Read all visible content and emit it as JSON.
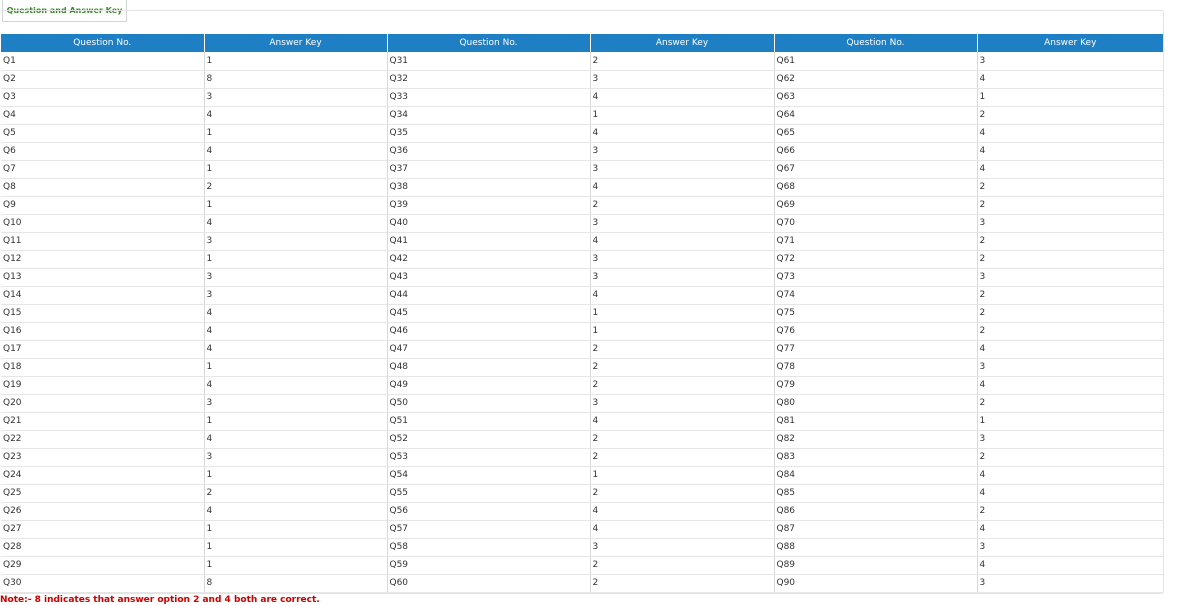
{
  "tab_label": "Question and Answer Key",
  "headers": [
    "Question No.",
    "Answer Key",
    "Question No.",
    "Answer Key",
    "Question No.",
    "Answer Key"
  ],
  "rows": [
    [
      "Q1",
      "1",
      "Q31",
      "2",
      "Q61",
      "3"
    ],
    [
      "Q2",
      "8",
      "Q32",
      "3",
      "Q62",
      "4"
    ],
    [
      "Q3",
      "3",
      "Q33",
      "4",
      "Q63",
      "1"
    ],
    [
      "Q4",
      "4",
      "Q34",
      "1",
      "Q64",
      "2"
    ],
    [
      "Q5",
      "1",
      "Q35",
      "4",
      "Q65",
      "4"
    ],
    [
      "Q6",
      "4",
      "Q36",
      "3",
      "Q66",
      "4"
    ],
    [
      "Q7",
      "1",
      "Q37",
      "3",
      "Q67",
      "4"
    ],
    [
      "Q8",
      "2",
      "Q38",
      "4",
      "Q68",
      "2"
    ],
    [
      "Q9",
      "1",
      "Q39",
      "2",
      "Q69",
      "2"
    ],
    [
      "Q10",
      "4",
      "Q40",
      "3",
      "Q70",
      "3"
    ],
    [
      "Q11",
      "3",
      "Q41",
      "4",
      "Q71",
      "2"
    ],
    [
      "Q12",
      "1",
      "Q42",
      "3",
      "Q72",
      "2"
    ],
    [
      "Q13",
      "3",
      "Q43",
      "3",
      "Q73",
      "3"
    ],
    [
      "Q14",
      "3",
      "Q44",
      "4",
      "Q74",
      "2"
    ],
    [
      "Q15",
      "4",
      "Q45",
      "1",
      "Q75",
      "2"
    ],
    [
      "Q16",
      "4",
      "Q46",
      "1",
      "Q76",
      "2"
    ],
    [
      "Q17",
      "4",
      "Q47",
      "2",
      "Q77",
      "4"
    ],
    [
      "Q18",
      "1",
      "Q48",
      "2",
      "Q78",
      "3"
    ],
    [
      "Q19",
      "4",
      "Q49",
      "2",
      "Q79",
      "4"
    ],
    [
      "Q20",
      "3",
      "Q50",
      "3",
      "Q80",
      "2"
    ],
    [
      "Q21",
      "1",
      "Q51",
      "4",
      "Q81",
      "1"
    ],
    [
      "Q22",
      "4",
      "Q52",
      "2",
      "Q82",
      "3"
    ],
    [
      "Q23",
      "3",
      "Q53",
      "2",
      "Q83",
      "2"
    ],
    [
      "Q24",
      "1",
      "Q54",
      "1",
      "Q84",
      "4"
    ],
    [
      "Q25",
      "2",
      "Q55",
      "2",
      "Q85",
      "4"
    ],
    [
      "Q26",
      "4",
      "Q56",
      "4",
      "Q86",
      "2"
    ],
    [
      "Q27",
      "1",
      "Q57",
      "4",
      "Q87",
      "4"
    ],
    [
      "Q28",
      "1",
      "Q58",
      "3",
      "Q88",
      "3"
    ],
    [
      "Q29",
      "1",
      "Q59",
      "2",
      "Q89",
      "4"
    ],
    [
      "Q30",
      "8",
      "Q60",
      "2",
      "Q90",
      "3"
    ]
  ],
  "note": "Note:- 8 indicates that answer option 2 and 4 both are correct.",
  "colors": {
    "header_bg": "#1f7fc4",
    "tab_text": "#3a8a2a",
    "note_text": "#cc0000"
  }
}
